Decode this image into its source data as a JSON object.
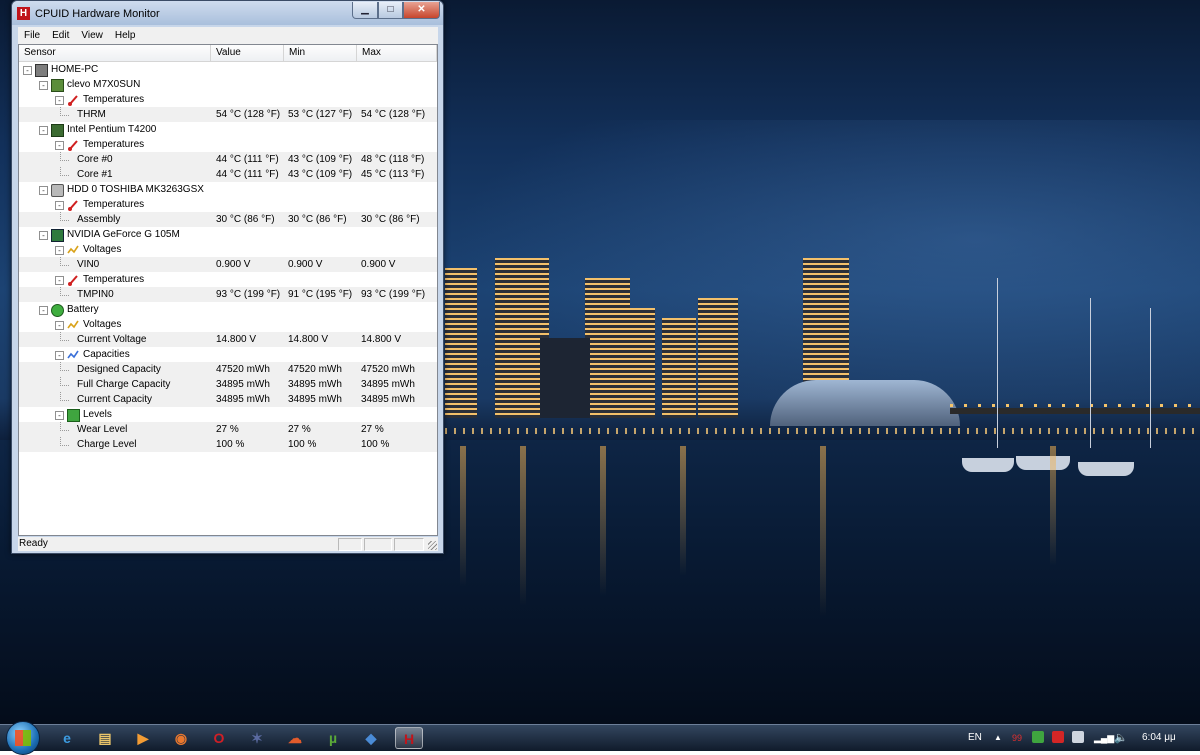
{
  "window": {
    "title": "CPUID Hardware Monitor",
    "app_icon_letter": "H",
    "buttons": {
      "minimize": "▁",
      "maximize": "□",
      "close": "✕"
    }
  },
  "menu": [
    "File",
    "Edit",
    "View",
    "Help"
  ],
  "columns": [
    "Sensor",
    "Value",
    "Min",
    "Max"
  ],
  "rows": [
    {
      "level": 0,
      "icon": "computer-icon",
      "label": "HOME-PC",
      "toggle": "-",
      "value": "",
      "min": "",
      "max": ""
    },
    {
      "level": 1,
      "icon": "motherboard-icon",
      "label": "clevo M7X0SUN",
      "toggle": "-",
      "value": "",
      "min": "",
      "max": ""
    },
    {
      "level": 2,
      "icon": "thermometer-icon",
      "label": "Temperatures",
      "toggle": "-",
      "value": "",
      "min": "",
      "max": ""
    },
    {
      "level": 3,
      "icon": "",
      "label": "THRM",
      "toggle": "",
      "value": "54 °C  (128 °F)",
      "min": "53 °C  (127 °F)",
      "max": "54 °C  (128 °F)"
    },
    {
      "level": 1,
      "icon": "cpu-icon",
      "label": "Intel Pentium T4200",
      "toggle": "-",
      "value": "",
      "min": "",
      "max": ""
    },
    {
      "level": 2,
      "icon": "thermometer-icon",
      "label": "Temperatures",
      "toggle": "-",
      "value": "",
      "min": "",
      "max": ""
    },
    {
      "level": 3,
      "icon": "",
      "label": "Core #0",
      "toggle": "",
      "value": "44 °C  (111 °F)",
      "min": "43 °C  (109 °F)",
      "max": "48 °C  (118 °F)"
    },
    {
      "level": 3,
      "icon": "",
      "label": "Core #1",
      "toggle": "",
      "value": "44 °C  (111 °F)",
      "min": "43 °C  (109 °F)",
      "max": "45 °C  (113 °F)"
    },
    {
      "level": 1,
      "icon": "hard-drive-icon",
      "label": "HDD 0 TOSHIBA MK3263GSX",
      "toggle": "-",
      "value": "",
      "min": "",
      "max": ""
    },
    {
      "level": 2,
      "icon": "thermometer-icon",
      "label": "Temperatures",
      "toggle": "-",
      "value": "",
      "min": "",
      "max": ""
    },
    {
      "level": 3,
      "icon": "",
      "label": "Assembly",
      "toggle": "",
      "value": "30 °C  (86 °F)",
      "min": "30 °C  (86 °F)",
      "max": "30 °C  (86 °F)"
    },
    {
      "level": 1,
      "icon": "gpu-icon",
      "label": "NVIDIA GeForce G 105M",
      "toggle": "-",
      "value": "",
      "min": "",
      "max": ""
    },
    {
      "level": 2,
      "icon": "voltage-icon",
      "label": "Voltages",
      "toggle": "-",
      "value": "",
      "min": "",
      "max": ""
    },
    {
      "level": 3,
      "icon": "",
      "label": "VIN0",
      "toggle": "",
      "value": "0.900 V",
      "min": "0.900 V",
      "max": "0.900 V"
    },
    {
      "level": 2,
      "icon": "thermometer-icon",
      "label": "Temperatures",
      "toggle": "-",
      "value": "",
      "min": "",
      "max": ""
    },
    {
      "level": 3,
      "icon": "",
      "label": "TMPIN0",
      "toggle": "",
      "value": "93 °C  (199 °F)",
      "min": "91 °C  (195 °F)",
      "max": "93 °C  (199 °F)"
    },
    {
      "level": 1,
      "icon": "battery-icon",
      "label": "Battery",
      "toggle": "-",
      "value": "",
      "min": "",
      "max": ""
    },
    {
      "level": 2,
      "icon": "voltage-icon",
      "label": "Voltages",
      "toggle": "-",
      "value": "",
      "min": "",
      "max": ""
    },
    {
      "level": 3,
      "icon": "",
      "label": "Current Voltage",
      "toggle": "",
      "value": "14.800 V",
      "min": "14.800 V",
      "max": "14.800 V"
    },
    {
      "level": 2,
      "icon": "capacity-icon",
      "label": "Capacities",
      "toggle": "-",
      "value": "",
      "min": "",
      "max": ""
    },
    {
      "level": 3,
      "icon": "",
      "label": "Designed Capacity",
      "toggle": "",
      "value": "47520 mWh",
      "min": "47520 mWh",
      "max": "47520 mWh"
    },
    {
      "level": 3,
      "icon": "",
      "label": "Full Charge Capacity",
      "toggle": "",
      "value": "34895 mWh",
      "min": "34895 mWh",
      "max": "34895 mWh"
    },
    {
      "level": 3,
      "icon": "",
      "label": "Current Capacity",
      "toggle": "",
      "value": "34895 mWh",
      "min": "34895 mWh",
      "max": "34895 mWh"
    },
    {
      "level": 2,
      "icon": "level-icon",
      "label": "Levels",
      "toggle": "-",
      "value": "",
      "min": "",
      "max": ""
    },
    {
      "level": 3,
      "icon": "",
      "label": "Wear Level",
      "toggle": "",
      "value": "27 %",
      "min": "27 %",
      "max": "27 %"
    },
    {
      "level": 3,
      "icon": "",
      "label": "Charge Level",
      "toggle": "",
      "value": "100 %",
      "min": "100 %",
      "max": "100 %"
    }
  ],
  "status": {
    "text": "Ready"
  },
  "taskbar": {
    "apps": [
      {
        "name": "internet-explorer",
        "glyph": "e",
        "color": "#3c9be0"
      },
      {
        "name": "explorer",
        "glyph": "▤",
        "color": "#e9c46a"
      },
      {
        "name": "media-player",
        "glyph": "▶",
        "color": "#f39c34"
      },
      {
        "name": "firefox",
        "glyph": "◉",
        "color": "#e8772e"
      },
      {
        "name": "opera",
        "glyph": "O",
        "color": "#d21f26"
      },
      {
        "name": "app-dark",
        "glyph": "✶",
        "color": "#5a6aa0"
      },
      {
        "name": "app-swirl",
        "glyph": "☁",
        "color": "#e25b2b"
      },
      {
        "name": "utorrent",
        "glyph": "µ",
        "color": "#5aa938"
      },
      {
        "name": "app-blue",
        "glyph": "◆",
        "color": "#4a8bd6"
      },
      {
        "name": "hwmonitor",
        "glyph": "H",
        "color": "#c0141b"
      }
    ],
    "language": "EN",
    "tray_badge": "99",
    "clock": "6:04 μμ"
  }
}
